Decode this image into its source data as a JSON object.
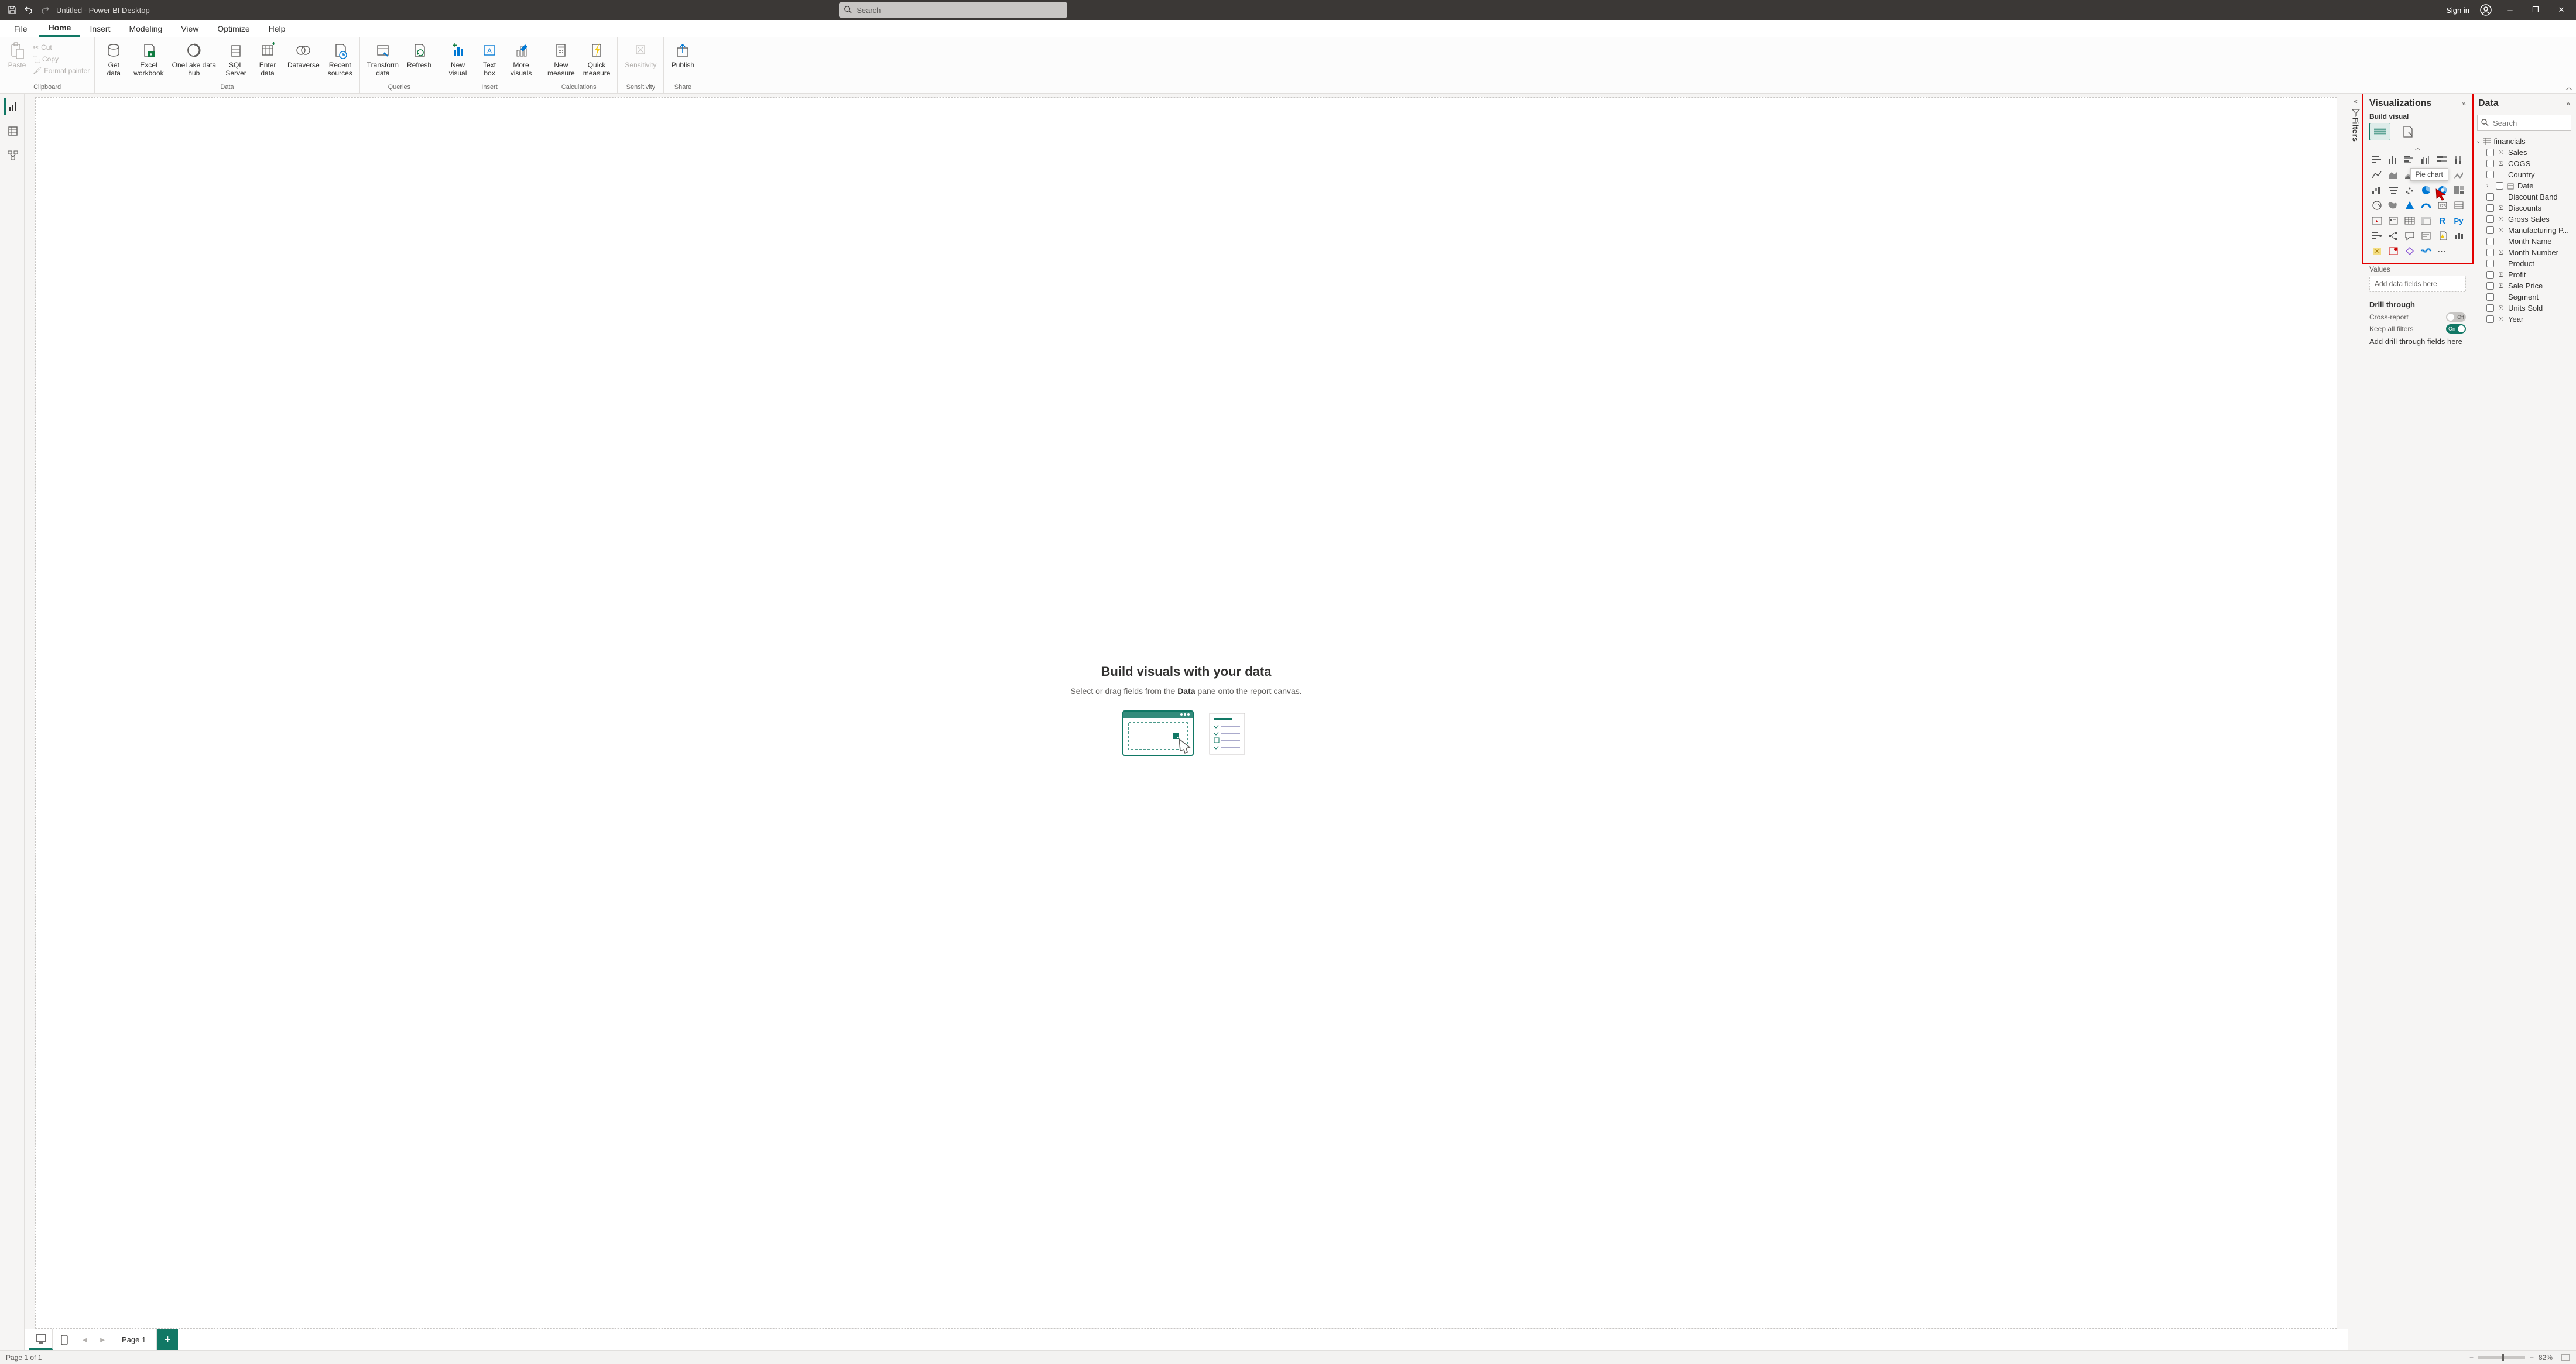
{
  "titlebar": {
    "title": "Untitled - Power BI Desktop",
    "search_placeholder": "Search",
    "signin": "Sign in"
  },
  "ribbon_tabs": {
    "file": "File",
    "home": "Home",
    "insert": "Insert",
    "modeling": "Modeling",
    "view": "View",
    "optimize": "Optimize",
    "help": "Help"
  },
  "ribbon": {
    "clipboard": {
      "paste": "Paste",
      "cut": "Cut",
      "copy": "Copy",
      "format_painter": "Format painter",
      "label": "Clipboard"
    },
    "data": {
      "get_data": "Get\ndata",
      "excel": "Excel\nworkbook",
      "onelake": "OneLake data\nhub",
      "sql": "SQL\nServer",
      "enter": "Enter\ndata",
      "dataverse": "Dataverse",
      "recent": "Recent\nsources",
      "label": "Data"
    },
    "queries": {
      "transform": "Transform\ndata",
      "refresh": "Refresh",
      "label": "Queries"
    },
    "insert": {
      "new_visual": "New\nvisual",
      "text_box": "Text\nbox",
      "more_visuals": "More\nvisuals",
      "label": "Insert"
    },
    "calc": {
      "new_measure": "New\nmeasure",
      "quick_measure": "Quick\nmeasure",
      "label": "Calculations"
    },
    "sensitivity": {
      "btn": "Sensitivity",
      "label": "Sensitivity"
    },
    "share": {
      "publish": "Publish",
      "label": "Share"
    }
  },
  "canvas": {
    "heading": "Build visuals with your data",
    "sub_pre": "Select or drag fields from the ",
    "sub_bold": "Data",
    "sub_post": " pane onto the report canvas."
  },
  "pages": {
    "page1": "Page 1"
  },
  "filters_label": "Filters",
  "viz": {
    "title": "Visualizations",
    "build": "Build visual",
    "tooltip": "Pie chart",
    "values": "Values",
    "values_placeholder": "Add data fields here",
    "drill": "Drill through",
    "cross": "Cross-report",
    "cross_state": "Off",
    "keep": "Keep all filters",
    "keep_state": "On",
    "drill_placeholder": "Add drill-through fields here"
  },
  "data_pane": {
    "title": "Data",
    "search_placeholder": "Search",
    "table": "financials",
    "fields": [
      {
        "name": "Sales",
        "sigma": true
      },
      {
        "name": "COGS",
        "sigma": true
      },
      {
        "name": "Country",
        "sigma": false
      },
      {
        "name": "Date",
        "sigma": false,
        "date": true,
        "expandable": true
      },
      {
        "name": "Discount Band",
        "sigma": false
      },
      {
        "name": "Discounts",
        "sigma": true
      },
      {
        "name": "Gross Sales",
        "sigma": true
      },
      {
        "name": "Manufacturing P...",
        "sigma": true
      },
      {
        "name": "Month Name",
        "sigma": false
      },
      {
        "name": "Month Number",
        "sigma": true
      },
      {
        "name": "Product",
        "sigma": false
      },
      {
        "name": "Profit",
        "sigma": true
      },
      {
        "name": "Sale Price",
        "sigma": true
      },
      {
        "name": "Segment",
        "sigma": false
      },
      {
        "name": "Units Sold",
        "sigma": true
      },
      {
        "name": "Year",
        "sigma": true
      }
    ]
  },
  "status": {
    "page": "Page 1 of 1",
    "zoom": "82%"
  }
}
